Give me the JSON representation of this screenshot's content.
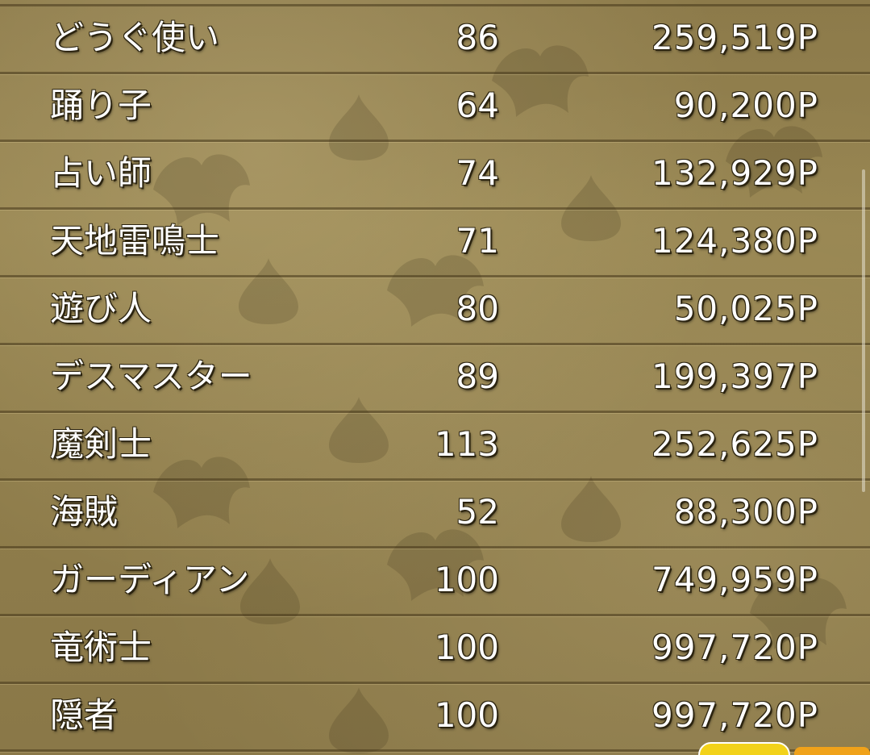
{
  "rows": [
    {
      "name": "どうぐ使い",
      "level": "86",
      "points": "259,519P"
    },
    {
      "name": "踊り子",
      "level": "64",
      "points": "90,200P"
    },
    {
      "name": "占い師",
      "level": "74",
      "points": "132,929P"
    },
    {
      "name": "天地雷鳴士",
      "level": "71",
      "points": "124,380P"
    },
    {
      "name": "遊び人",
      "level": "80",
      "points": "50,025P"
    },
    {
      "name": "デスマスター",
      "level": "89",
      "points": "199,397P"
    },
    {
      "name": "魔剣士",
      "level": "113",
      "points": "252,625P"
    },
    {
      "name": "海賊",
      "level": "52",
      "points": "88,300P"
    },
    {
      "name": "ガーディアン",
      "level": "100",
      "points": "749,959P"
    },
    {
      "name": "竜術士",
      "level": "100",
      "points": "997,720P"
    },
    {
      "name": "隠者",
      "level": "100",
      "points": "997,720P"
    }
  ],
  "colors": {
    "background": "#8f7d4b",
    "text": "#ffffff",
    "text_outline": "#2c2410",
    "row_divider": "#46371a",
    "badge_yellow": "#f2d21a",
    "badge_orange": "#f0a21a"
  }
}
